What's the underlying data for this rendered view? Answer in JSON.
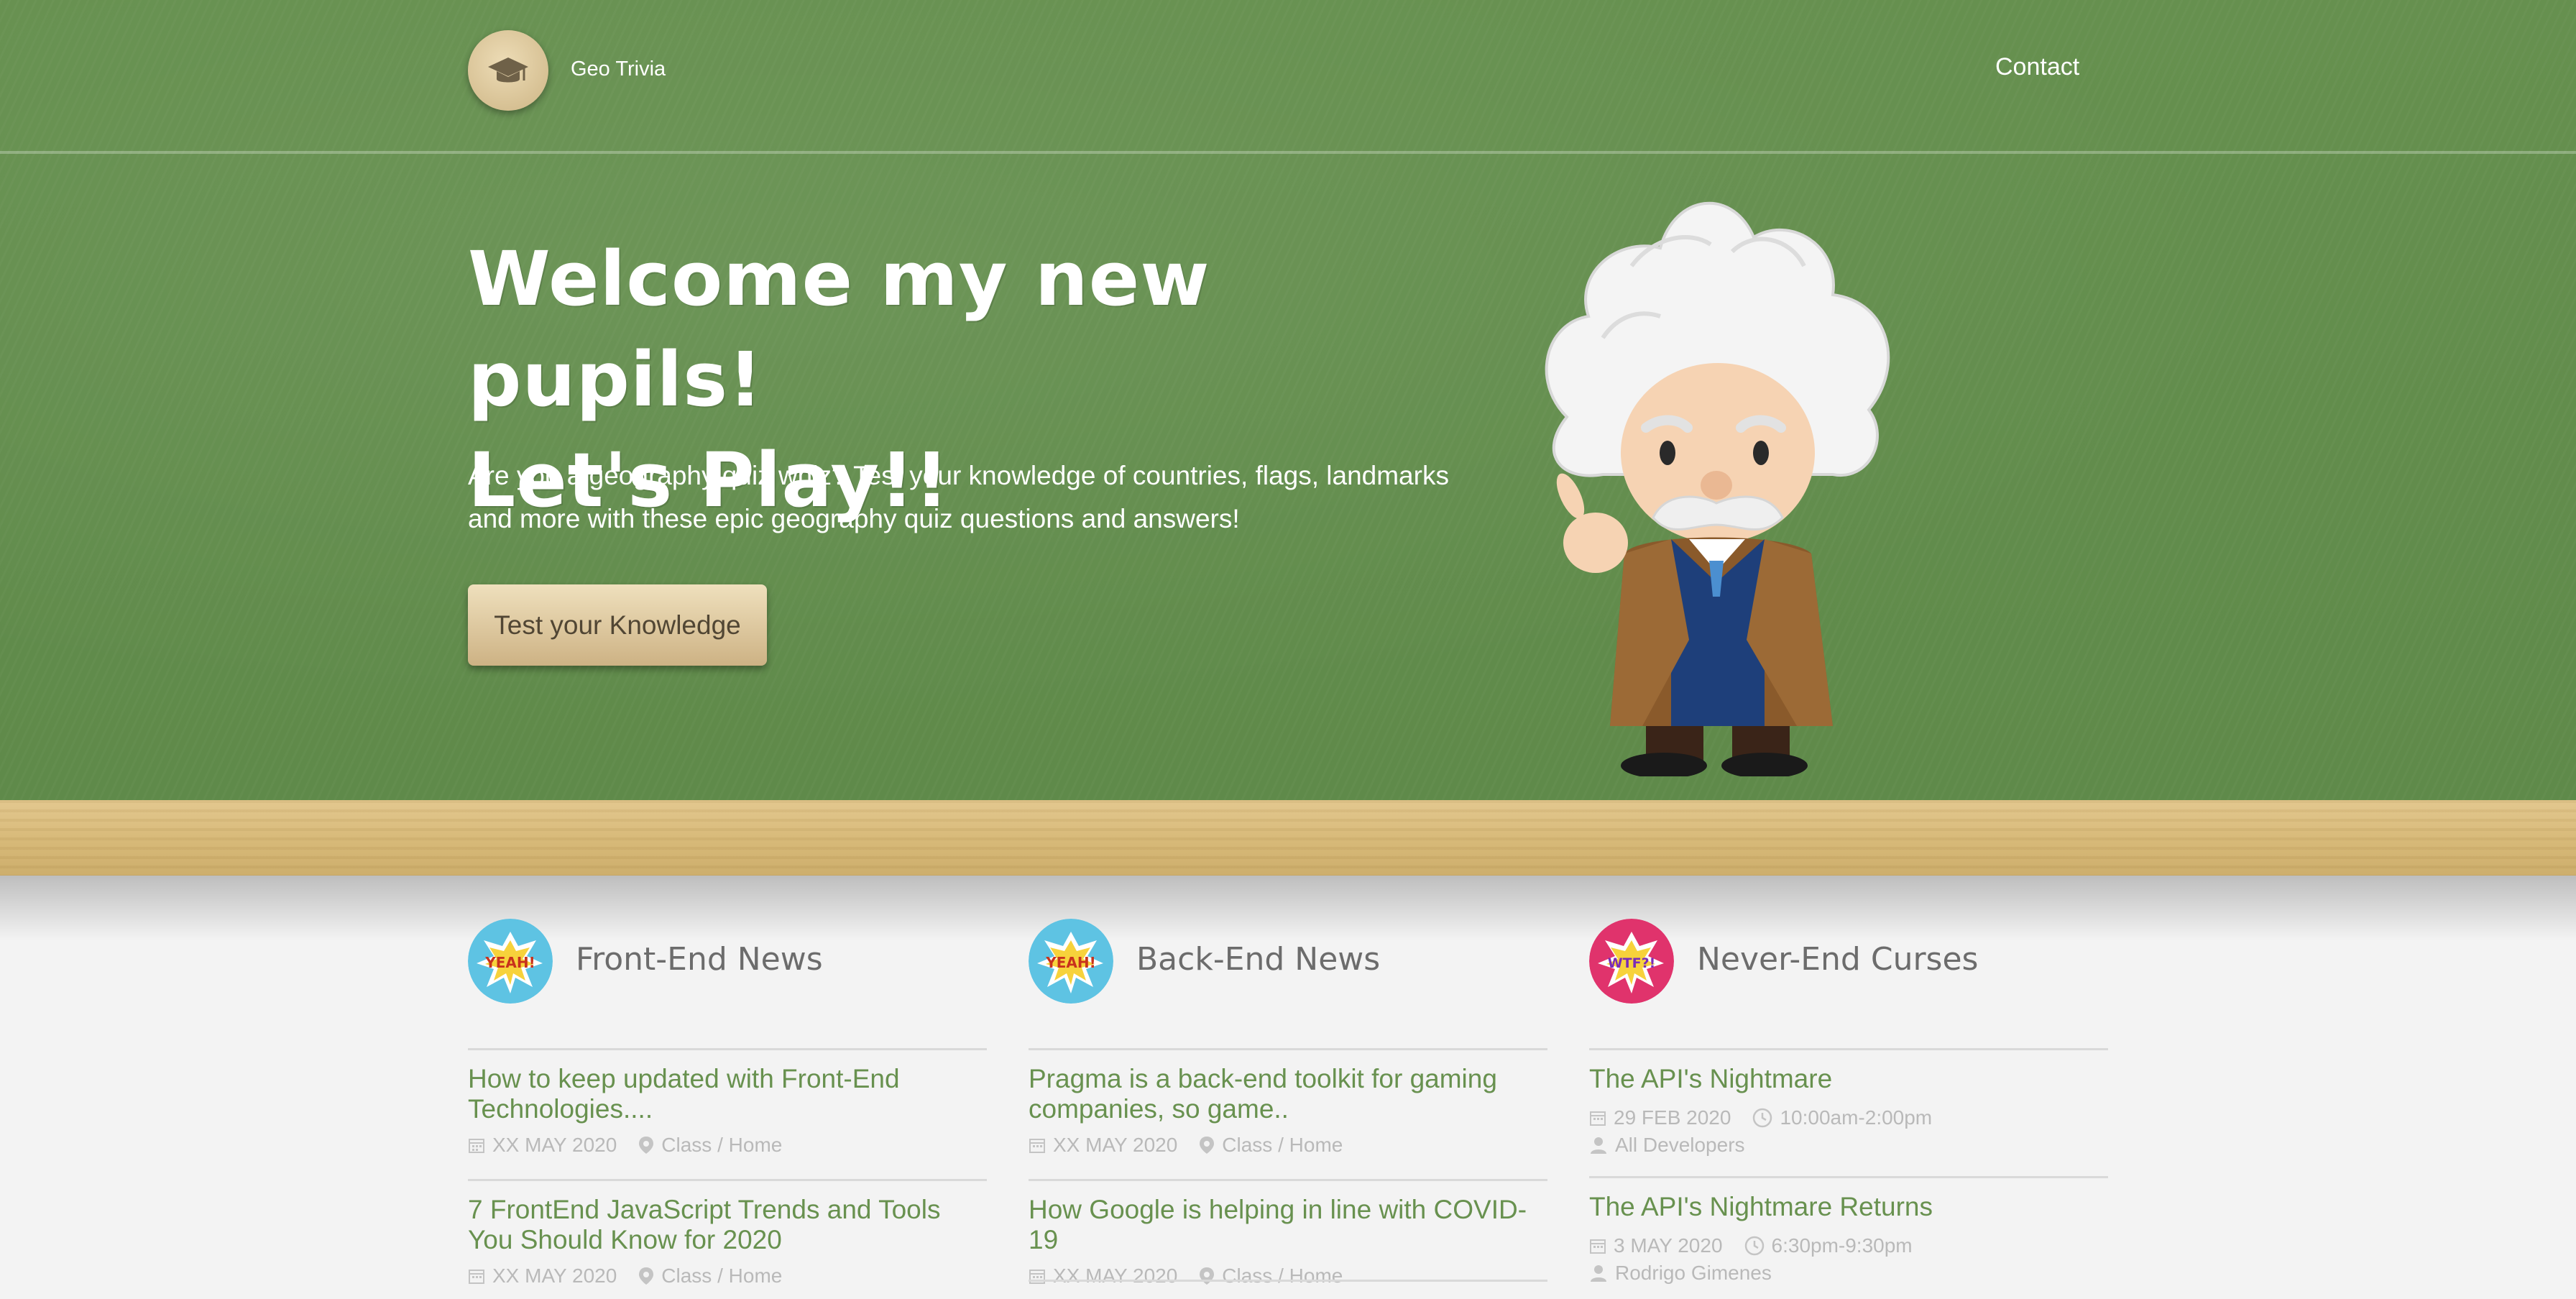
{
  "header": {
    "brand": "Geo Trivia",
    "contact": "Contact"
  },
  "hero": {
    "headline_line1": "Welcome my new pupils!",
    "headline_line2": "Let's Play!!",
    "intro": "Are you a geography quiz whiz? Test your knowledge of countries, flags, landmarks and more with these epic geography quiz questions and answers!",
    "cta": "Test your Knowledge"
  },
  "columns": [
    {
      "title": "Front-End News",
      "badge": "YEAH!",
      "badge_color": "#5ec3e3",
      "items": [
        {
          "title": "How to keep updated with Front-End Technologies....",
          "date": "XX MAY 2020",
          "location": "Class / Home"
        },
        {
          "title": "7 FrontEnd JavaScript Trends and Tools You Should Know for 2020",
          "date": "XX MAY 2020",
          "location": "Class / Home"
        }
      ]
    },
    {
      "title": "Back-End News",
      "badge": "YEAH!",
      "badge_color": "#5ec3e3",
      "items": [
        {
          "title": "Pragma is a back-end toolkit for gaming companies, so game..",
          "date": "XX MAY 2020",
          "location": "Class / Home"
        },
        {
          "title": "How Google is helping in line with COVID-19",
          "date": "XX MAY 2020",
          "location": "Class / Home"
        }
      ]
    },
    {
      "title": "Never-End Curses",
      "badge": "WTF?!",
      "badge_color": "#e0336c",
      "items": [
        {
          "title": "The API's Nightmare",
          "date": "29 FEB 2020",
          "time": "10:00am-2:00pm",
          "person": "All Developers"
        },
        {
          "title": "The API's Nightmare Returns",
          "date": "3 MAY 2020",
          "time": "6:30pm-9:30pm",
          "person": "Rodrigo Gimenes"
        }
      ]
    }
  ],
  "colors": {
    "chalkboard": "#5f8a4a",
    "link": "#68914f",
    "meta": "#b9b9b9",
    "wood": "#d7b978"
  }
}
